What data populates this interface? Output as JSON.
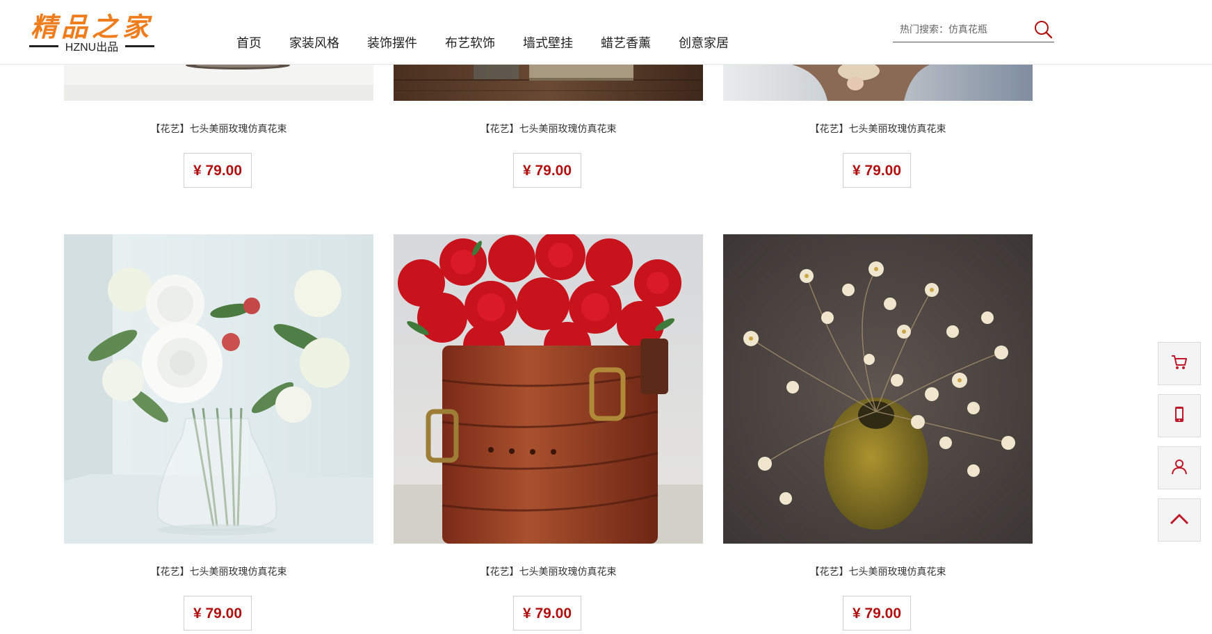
{
  "header": {
    "logo_title": "精品之家",
    "logo_sub": "HZNU出品",
    "nav": [
      "首页",
      "家装风格",
      "装饰摆件",
      "布艺软饰",
      "墙式壁挂",
      "蜡艺香薰",
      "创意家居"
    ],
    "search_placeholder": "热门搜索：仿真花瓶"
  },
  "products": [
    {
      "name": "【花艺】七头美丽玫瑰仿真花束",
      "price": "¥ 79.00"
    },
    {
      "name": "【花艺】七头美丽玫瑰仿真花束",
      "price": "¥ 79.00"
    },
    {
      "name": "【花艺】七头美丽玫瑰仿真花束",
      "price": "¥ 79.00"
    },
    {
      "name": "【花艺】七头美丽玫瑰仿真花束",
      "price": "¥ 79.00"
    },
    {
      "name": "【花艺】七头美丽玫瑰仿真花束",
      "price": "¥ 79.00"
    },
    {
      "name": "【花艺】七头美丽玫瑰仿真花束",
      "price": "¥ 79.00"
    }
  ],
  "colors": {
    "accent": "#b01010",
    "logo": "#ef7d1e"
  },
  "float_bar": [
    "cart-icon",
    "mobile-icon",
    "user-icon",
    "back-to-top-icon"
  ]
}
